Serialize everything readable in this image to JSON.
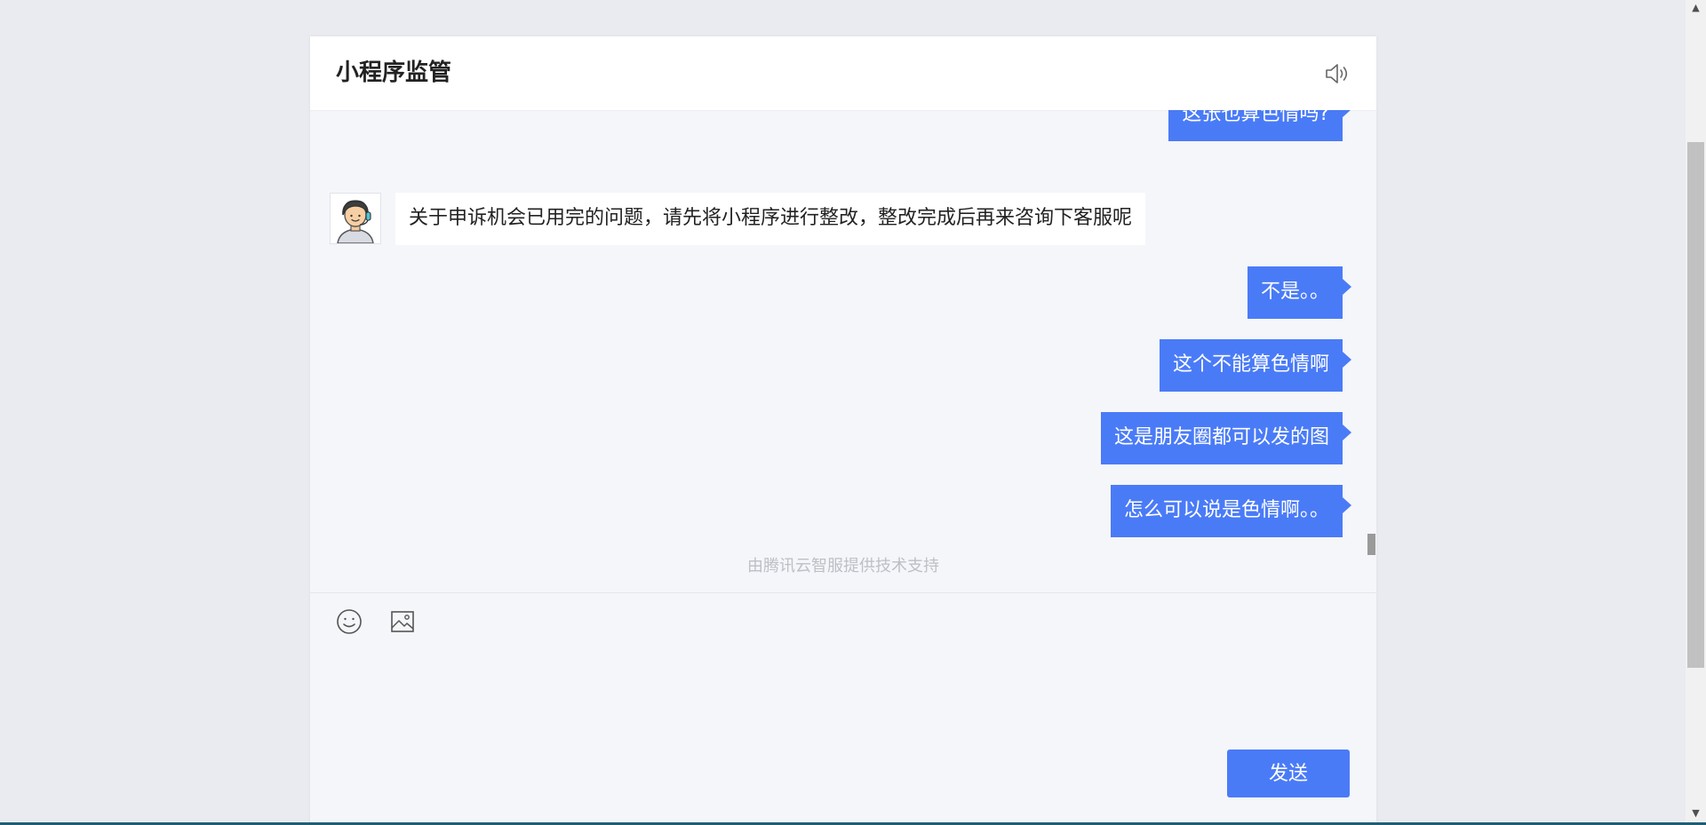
{
  "header": {
    "title": "小程序监管"
  },
  "messages": [
    {
      "from": "user",
      "text": "这张也算色情吗?"
    },
    {
      "from": "agent",
      "text": "关于申诉机会已用完的问题，请先将小程序进行整改，整改完成后再来咨询下客服呢"
    },
    {
      "from": "user",
      "text": "不是。。"
    },
    {
      "from": "user",
      "text": "这个不能算色情啊"
    },
    {
      "from": "user",
      "text": "这是朋友圈都可以发的图"
    },
    {
      "from": "user",
      "text": "怎么可以说是色情啊。。"
    }
  ],
  "footer_note": "由腾讯云智服提供技术支持",
  "composer": {
    "send_label": "发送"
  },
  "icons": {
    "speaker": "speaker-icon",
    "emoji": "emoji-icon",
    "image": "image-icon",
    "agent_avatar": "agent-avatar"
  },
  "colors": {
    "accent": "#4a7bf7",
    "background": "#e9ebf0",
    "chat_background": "#f5f6fa"
  }
}
